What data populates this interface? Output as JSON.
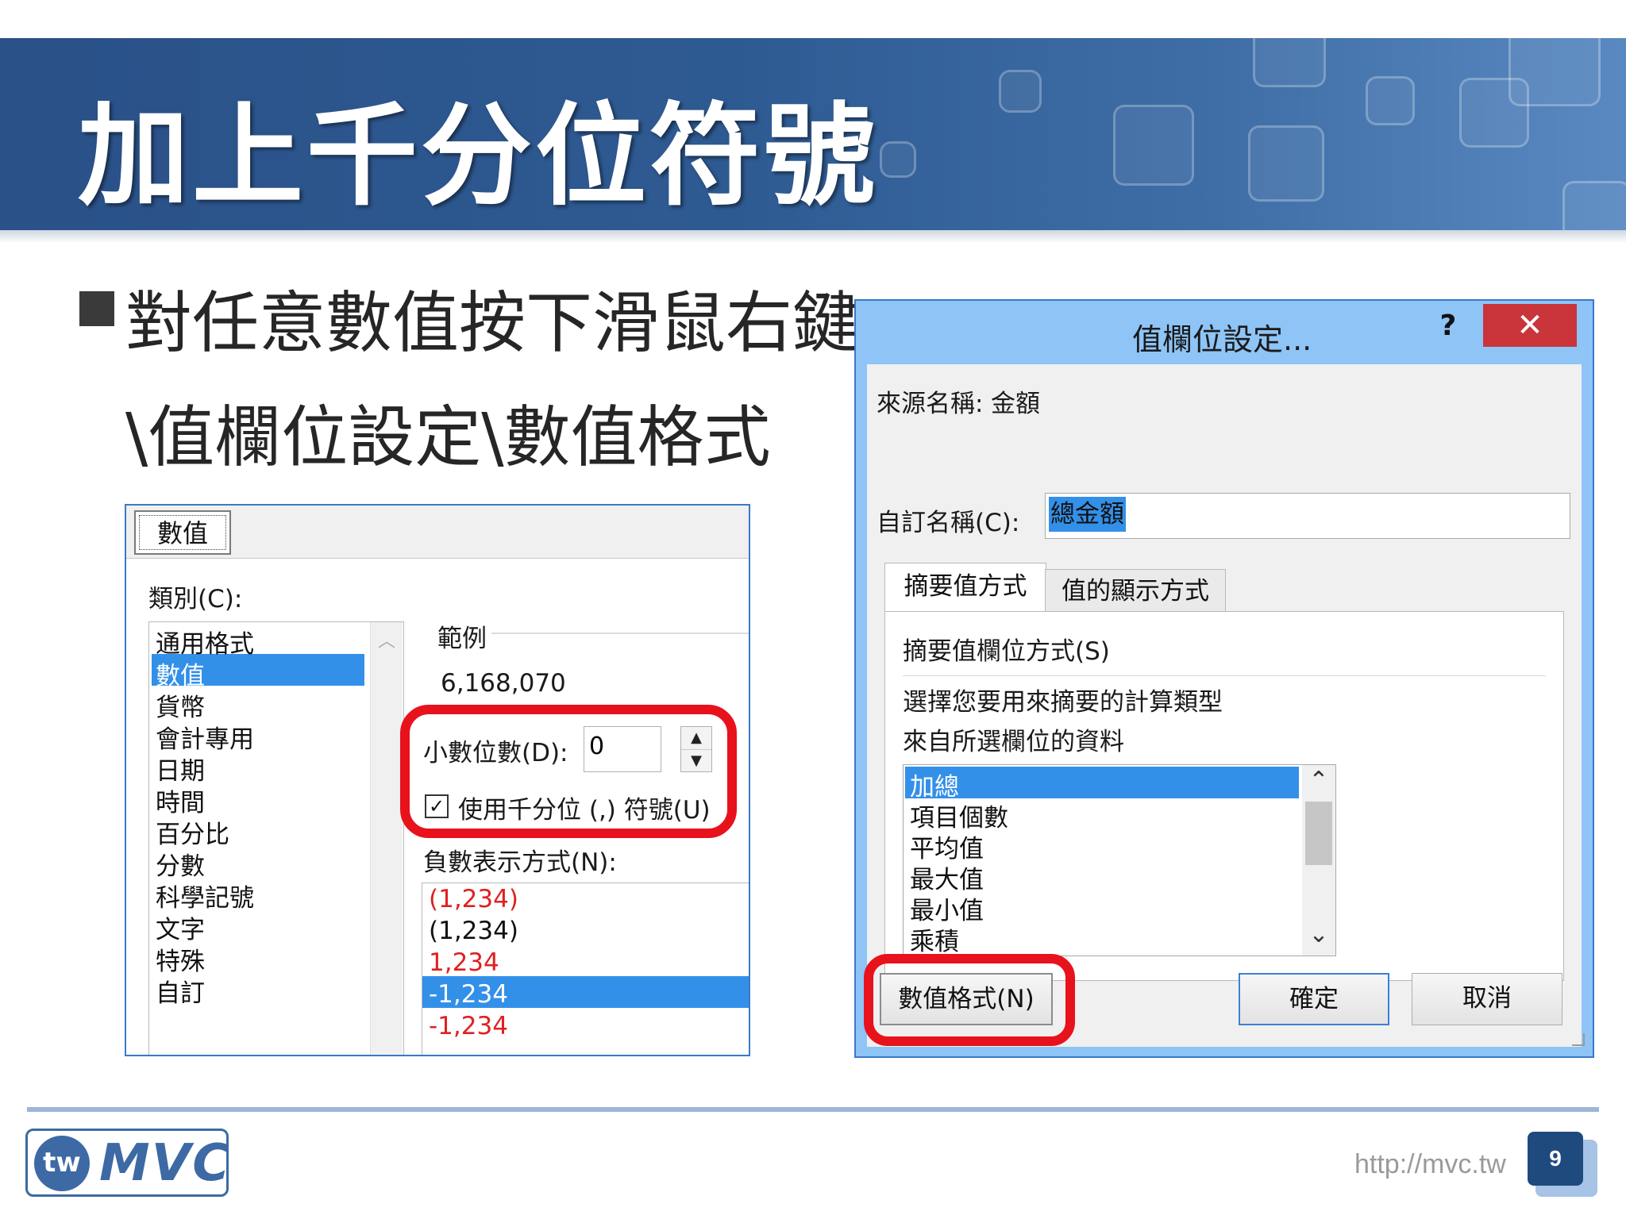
{
  "slide": {
    "title": "加上千分位符號",
    "bullet_line1": "對任意數值按下滑鼠右鍵",
    "bullet_line2": "\\值欄位設定\\數值格式",
    "url": "http://mvc.tw",
    "page_number": "9",
    "logo": {
      "prefix": "tw",
      "text": "MVC"
    }
  },
  "format_dialog": {
    "tab": "數值",
    "category_label": "類別(C):",
    "categories": [
      "通用格式",
      "數值",
      "貨幣",
      "會計專用",
      "日期",
      "時間",
      "百分比",
      "分數",
      "科學記號",
      "文字",
      "特殊",
      "自訂"
    ],
    "selected_category": "數值",
    "sample_label": "範例",
    "sample_value": "6,168,070",
    "decimal_label": "小數位數(D):",
    "decimal_value": "0",
    "thousands_label": "使用千分位 (,) 符號(U)",
    "thousands_checked": true,
    "negative_label": "負數表示方式(N):",
    "negative_formats": [
      {
        "text": "(1,234)",
        "color": "#e02020"
      },
      {
        "text": "(1,234)",
        "color": "#111111"
      },
      {
        "text": "1,234",
        "color": "#e02020"
      },
      {
        "text": "-1,234",
        "color": "#ffffff"
      },
      {
        "text": "-1,234",
        "color": "#e02020"
      }
    ]
  },
  "value_field_dialog": {
    "title": "值欄位設定...",
    "help": "?",
    "close": "✕",
    "source_label": "來源名稱:",
    "source_value": "金額",
    "custom_label": "自訂名稱(C):",
    "custom_value": "總金額",
    "tabs": [
      "摘要值方式",
      "值的顯示方式"
    ],
    "summarize_heading": "摘要值欄位方式(S)",
    "desc_line1": "選擇您要用來摘要的計算類型",
    "desc_line2": "來自所選欄位的資料",
    "functions": [
      "加總",
      "項目個數",
      "平均值",
      "最大值",
      "最小值",
      "乘積"
    ],
    "selected_function": "加總",
    "scroll_up": "⌃",
    "scroll_down": "⌄",
    "number_format_button": "數值格式(N)",
    "ok_button": "確定",
    "cancel_button": "取消"
  },
  "colors": {
    "header": "#2e5a92",
    "highlight": "#e8121c",
    "selection": "#3390e8"
  }
}
